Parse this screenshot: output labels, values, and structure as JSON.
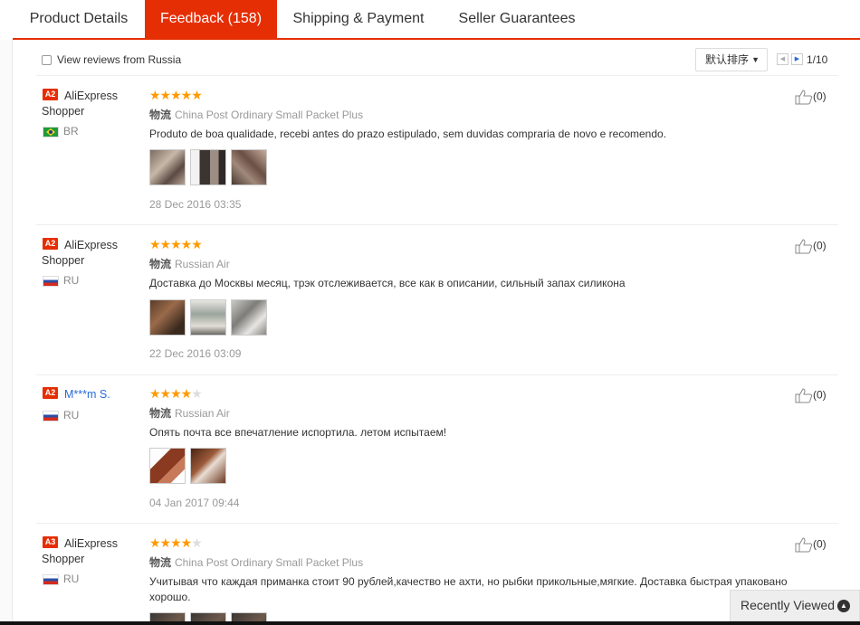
{
  "tabs": [
    {
      "label": "Product Details"
    },
    {
      "label": "Feedback (158)"
    },
    {
      "label": "Shipping & Payment"
    },
    {
      "label": "Seller Guarantees"
    }
  ],
  "filter": {
    "checkbox_label": "View reviews from Russia",
    "sort_label": "默认排序",
    "page_indicator": "1/10"
  },
  "shipping_prefix": "物流",
  "reviews": [
    {
      "badge": "A2",
      "name": "AliExpress Shopper",
      "country": "BR",
      "rating": 5,
      "stars_filled": "★★★★★",
      "stars_empty": "",
      "shipping": "China Post Ordinary Small Packet Plus",
      "text": "Produto de boa qualidade, recebi antes do prazo estipulado, sem duvidas compraria de novo e recomendo.",
      "date": "28 Dec 2016 03:35",
      "likes": "(0)"
    },
    {
      "badge": "A2",
      "name": "AliExpress Shopper",
      "country": "RU",
      "rating": 5,
      "stars_filled": "★★★★★",
      "stars_empty": "",
      "shipping": "Russian Air",
      "text": "Доставка до Москвы месяц, трэк отслеживается, все как в описании, сильный запах силикона",
      "date": "22 Dec 2016 03:09",
      "likes": "(0)"
    },
    {
      "badge": "A2",
      "name": "M***m S.",
      "country": "RU",
      "rating": 4,
      "stars_filled": "★★★★",
      "stars_empty": "★",
      "shipping": "Russian Air",
      "text": "Опять почта все впечатление испортила. летом испытаем!",
      "date": "04 Jan 2017 09:44",
      "likes": "(0)"
    },
    {
      "badge": "A3",
      "name": "AliExpress Shopper",
      "country": "RU",
      "rating": 4,
      "stars_filled": "★★★★",
      "stars_empty": "★",
      "shipping": "China Post Ordinary Small Packet Plus",
      "text": "Учитывая что каждая приманка стоит 90 рублей,качество не ахти, но рыбки прикольные,мягкие. Доставка быстрая упаковано хорошо.",
      "likes": "(0)"
    }
  ],
  "recently_viewed": "Recently Viewed",
  "colors": {
    "accent": "#e62e04",
    "star": "#ff9a00",
    "link": "#2a6ad8"
  }
}
